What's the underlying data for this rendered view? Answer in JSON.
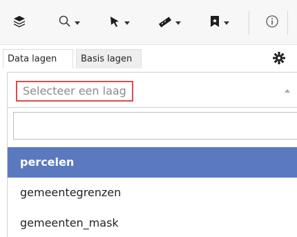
{
  "toolbar": {
    "buttons": [
      {
        "icon": "layers-icon"
      },
      {
        "icon": "search-icon"
      },
      {
        "icon": "select-arrow-icon"
      },
      {
        "icon": "measure-icon"
      },
      {
        "icon": "bookmark-icon"
      },
      {
        "icon": "info-icon"
      }
    ]
  },
  "tabs": [
    {
      "label": "Data lagen",
      "active": true
    },
    {
      "label": "Basis lagen",
      "active": false
    }
  ],
  "settings": {
    "icon": "gear-icon"
  },
  "layer_select": {
    "placeholder": "Selecteer een laag",
    "search_value": "",
    "options": [
      {
        "label": "percelen",
        "selected": true
      },
      {
        "label": "gemeentegrenzen",
        "selected": false
      },
      {
        "label": "gemeenten_mask",
        "selected": false
      }
    ]
  },
  "colors": {
    "accent": "#5b79bf",
    "highlight_border": "#e04a4a",
    "placeholder_text": "#8b8b8b"
  }
}
